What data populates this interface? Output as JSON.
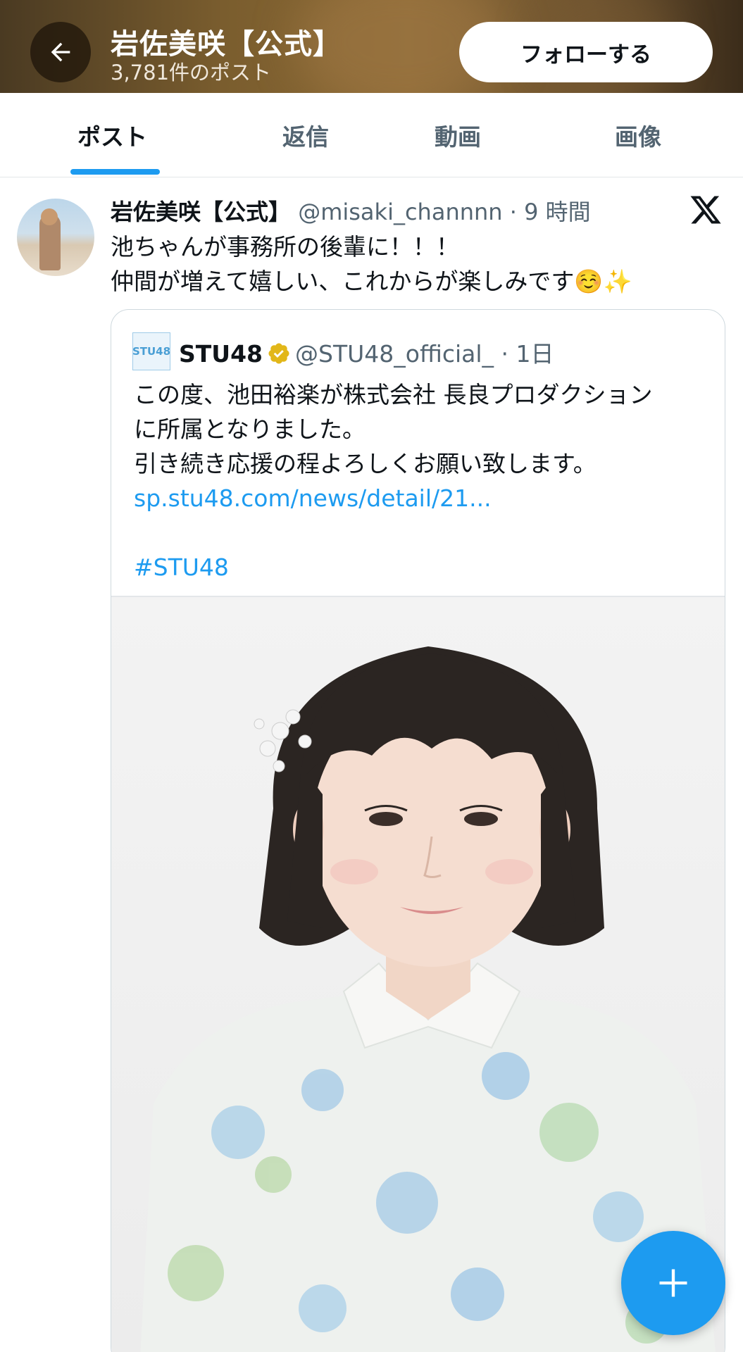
{
  "header": {
    "title": "岩佐美咲【公式】",
    "subtitle": "3,781件のポスト",
    "follow_label": "フォローする"
  },
  "tabs": [
    {
      "label": "ポスト",
      "active": true
    },
    {
      "label": "返信",
      "active": false
    },
    {
      "label": "動画",
      "active": false
    },
    {
      "label": "画像",
      "active": false
    }
  ],
  "post": {
    "author_name": "岩佐美咲【公式】",
    "handle": "@misaki_channnn",
    "time": "· 9 時間",
    "lines": [
      "池ちゃんが事務所の後輩に！！！",
      "仲間が増えて嬉しい、これからが楽しみです☺️✨"
    ],
    "quote": {
      "logo_text": "STU48",
      "author_name": "STU48",
      "handle": "@STU48_official_",
      "time": "· 1日",
      "lines": [
        "この度、池田裕楽が株式会社 長良プロダクション",
        "に所属となりました。",
        "引き続き応援の程よろしくお願い致します。"
      ],
      "link": "sp.stu48.com/news/detail/21...",
      "hashtag": "#STU48"
    }
  },
  "colors": {
    "accent": "#1d9bf0",
    "verified_gold": "#e2b719",
    "text_primary": "#0f1419",
    "text_secondary": "#536471"
  },
  "icons": {
    "back": "arrow-left-icon",
    "platform": "x-logo-icon",
    "verified": "verified-badge-icon",
    "compose": "plus-icon"
  }
}
